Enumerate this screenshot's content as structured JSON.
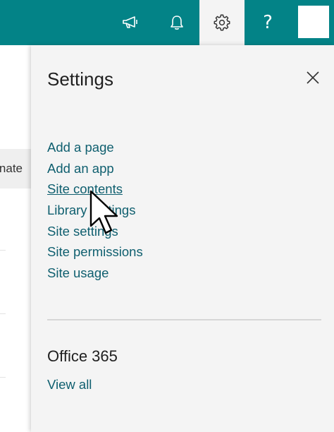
{
  "topbar": {
    "icons": [
      "megaphone-icon",
      "bell-icon",
      "gear-icon",
      "help-icon"
    ],
    "help_glyph": "?",
    "color": "#038387"
  },
  "background": {
    "partial_label": "nate"
  },
  "settings": {
    "title": "Settings",
    "links": [
      "Add a page",
      "Add an app",
      "Site contents",
      "Library settings",
      "Site settings",
      "Site permissions",
      "Site usage"
    ],
    "hovered_link": "Site contents"
  },
  "office": {
    "title": "Office 365",
    "view_all": "View all"
  },
  "colors": {
    "accent": "#038387",
    "link": "#0f5f6f",
    "panel": "#f4f4f4"
  }
}
